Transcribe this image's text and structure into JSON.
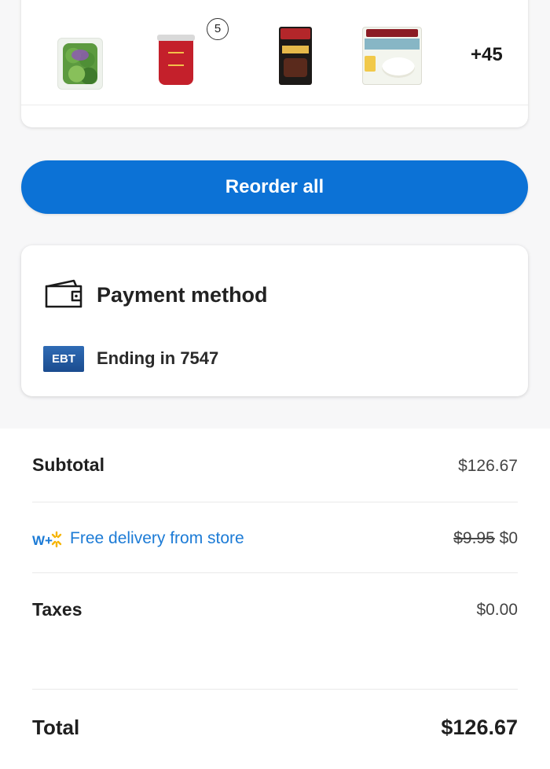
{
  "items": {
    "badge_count": "5",
    "more_count": "+45"
  },
  "reorder": {
    "label": "Reorder all"
  },
  "payment": {
    "title": "Payment method",
    "card_type": "EBT",
    "ending": "Ending in 7547"
  },
  "summary": {
    "subtotal_label": "Subtotal",
    "subtotal_value": "$126.67",
    "delivery_label": "Free delivery from store",
    "delivery_old_price": "$9.95",
    "delivery_price": "$0",
    "delivery_icon_text": "W+",
    "taxes_label": "Taxes",
    "taxes_value": "$0.00",
    "total_label": "Total",
    "total_value": "$126.67"
  },
  "colors": {
    "accent": "#0c72d6",
    "link": "#1c7bd6",
    "spark": "#f6b400"
  }
}
